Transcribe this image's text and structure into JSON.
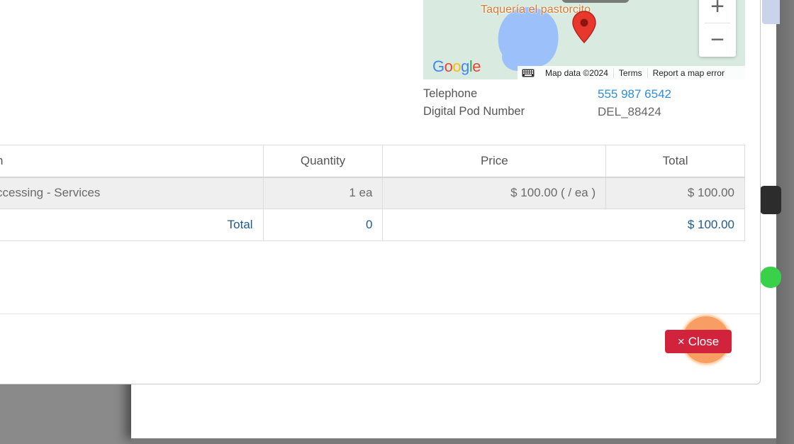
{
  "map": {
    "place_label": "Taquería el pastorcito",
    "attribution": "Google",
    "footer": {
      "map_data": "Map data ©2024",
      "terms": "Terms",
      "report": "Report a map error"
    },
    "zoom_in": "+",
    "zoom_out": "−"
  },
  "contact": {
    "telephone_label": "Telephone",
    "telephone_value": "555 987 6542",
    "pod_label": "Digital Pod Number",
    "pod_value": "DEL_88424"
  },
  "table": {
    "headers": [
      "n",
      "Quantity",
      "Price",
      "Total"
    ],
    "rows": [
      {
        "item": "ccessing - Services",
        "quantity": "1 ea",
        "price": "$ 100.00 ( / ea )",
        "total": "$ 100.00"
      }
    ],
    "total_row": {
      "label": "Total",
      "quantity": "0",
      "total": "$ 100.00"
    }
  },
  "footer": {
    "close_label": "Close",
    "close_icon": "×"
  },
  "colors": {
    "link": "#2f8ed8",
    "danger": "#d2233d",
    "map_pin": "#e8372d"
  }
}
